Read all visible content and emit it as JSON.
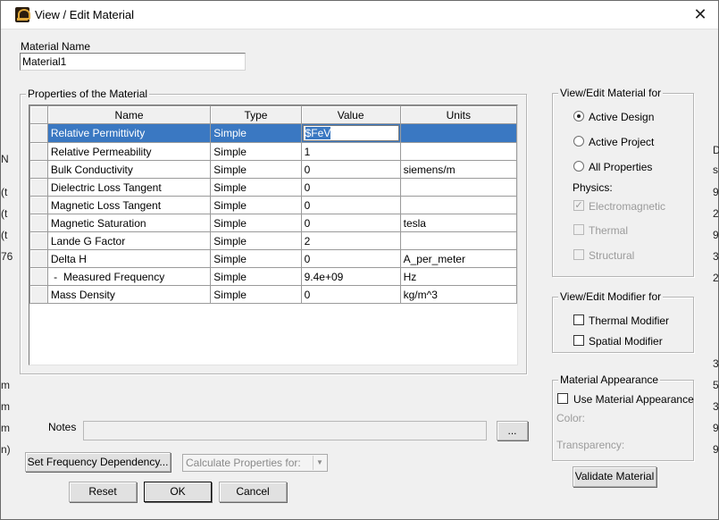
{
  "window": {
    "title": "View / Edit Material",
    "close_label": "✕",
    "icon": "hfss-app-icon"
  },
  "material_name": {
    "label": "Material Name",
    "value": "Material1"
  },
  "properties": {
    "group_title": "Properties of the Material",
    "columns": [
      "Name",
      "Type",
      "Value",
      "Units"
    ],
    "rows": [
      {
        "name": "Relative Permittivity",
        "type": "Simple",
        "value": "$FeV",
        "units": ""
      },
      {
        "name": "Relative Permeability",
        "type": "Simple",
        "value": "1",
        "units": ""
      },
      {
        "name": "Bulk Conductivity",
        "type": "Simple",
        "value": "0",
        "units": "siemens/m"
      },
      {
        "name": "Dielectric Loss Tangent",
        "type": "Simple",
        "value": "0",
        "units": ""
      },
      {
        "name": "Magnetic Loss Tangent",
        "type": "Simple",
        "value": "0",
        "units": ""
      },
      {
        "name": "Magnetic Saturation",
        "type": "Simple",
        "value": "0",
        "units": "tesla"
      },
      {
        "name": "Lande G Factor",
        "type": "Simple",
        "value": "2",
        "units": ""
      },
      {
        "name": "Delta H",
        "type": "Simple",
        "value": "0",
        "units": "A_per_meter"
      },
      {
        "name": " -  Measured Frequency",
        "type": "Simple",
        "value": "9.4e+09",
        "units": "Hz"
      },
      {
        "name": "Mass Density",
        "type": "Simple",
        "value": "0",
        "units": "kg/m^3"
      }
    ]
  },
  "view_edit_for": {
    "group_title": "View/Edit Material for",
    "options": [
      "Active Design",
      "Active Project",
      "All Properties"
    ],
    "selected": "Active Design",
    "physics_label": "Physics:",
    "physics": [
      {
        "label": "Electromagnetic",
        "checked": true,
        "disabled": true
      },
      {
        "label": "Thermal",
        "checked": false,
        "disabled": true
      },
      {
        "label": "Structural",
        "checked": false,
        "disabled": true
      }
    ]
  },
  "modifier": {
    "group_title": "View/Edit Modifier for",
    "thermal_label": "Thermal Modifier",
    "spatial_label": "Spatial Modifier"
  },
  "appearance": {
    "group_title": "Material Appearance",
    "use_label": "Use Material Appearance",
    "color_label": "Color:",
    "transparency_label": "Transparency:"
  },
  "notes": {
    "label": "Notes",
    "value": "",
    "browse_label": "..."
  },
  "buttons": {
    "set_frequency": "Set Frequency Dependency...",
    "calculate_placeholder": "Calculate Properties for:",
    "validate": "Validate Material",
    "reset": "Reset",
    "ok": "OK",
    "cancel": "Cancel"
  },
  "background_glyphs": [
    "D",
    "s",
    "9",
    "2",
    "9",
    "3",
    "2",
    "3",
    "5",
    "3",
    "9",
    "9"
  ],
  "background_left_glyphs": [
    "N",
    "(t",
    "(t",
    "(t",
    "76",
    "m",
    "m",
    "m",
    "n)"
  ]
}
